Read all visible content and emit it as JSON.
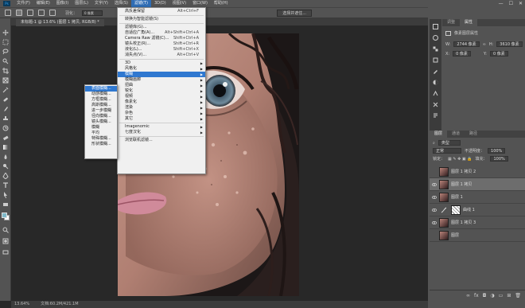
{
  "menubar": {
    "logo": "Ps",
    "items": [
      "文件(F)",
      "编辑(E)",
      "图像(I)",
      "图层(L)",
      "文字(Y)",
      "选择(S)",
      "滤镜(T)",
      "3D(D)",
      "视图(V)",
      "窗口(W)",
      "帮助(H)"
    ],
    "active_index": 6,
    "window_buttons": [
      "—",
      "☐",
      "✕"
    ]
  },
  "options_bar": {
    "feather_label": "羽化：",
    "feather_value": "0 像素",
    "refine_button": "选择并遮住..."
  },
  "document": {
    "tab_title": "未标题-1 @ 13.6% (图层 1 拷贝, RGB/8) *",
    "zoom": "13.64%",
    "doc_info": "文档:60.2M/421.1M"
  },
  "filter_menu": {
    "items": [
      {
        "label": "高反差保留",
        "shortcut": "Alt+Ctrl+F"
      },
      {
        "sep": true
      },
      {
        "label": "转换为智能滤镜(S)"
      },
      {
        "sep": true
      },
      {
        "label": "滤镜库(G)..."
      },
      {
        "label": "自适应广角(A)...",
        "shortcut": "Alt+Shift+Ctrl+A"
      },
      {
        "label": "Camera Raw 滤镜(C)...",
        "shortcut": "Shift+Ctrl+A"
      },
      {
        "label": "镜头校正(R)...",
        "shortcut": "Shift+Ctrl+R"
      },
      {
        "label": "液化(L)...",
        "shortcut": "Shift+Ctrl+X"
      },
      {
        "label": "消失点(V)...",
        "shortcut": "Alt+Ctrl+V"
      },
      {
        "sep": true
      },
      {
        "label": "3D",
        "sub": true
      },
      {
        "label": "风格化",
        "sub": true
      },
      {
        "label": "模糊",
        "sub": true,
        "highlight": true
      },
      {
        "label": "模糊画廊",
        "sub": true
      },
      {
        "label": "扭曲",
        "sub": true
      },
      {
        "label": "锐化",
        "sub": true
      },
      {
        "label": "视频",
        "sub": true
      },
      {
        "label": "像素化",
        "sub": true
      },
      {
        "label": "渲染",
        "sub": true
      },
      {
        "label": "杂色",
        "sub": true
      },
      {
        "label": "其它",
        "sub": true
      },
      {
        "sep": true
      },
      {
        "label": "Imagenomic",
        "sub": true
      },
      {
        "label": "七度汉化",
        "sub": true
      },
      {
        "sep": true
      },
      {
        "label": "浏览联机滤镜..."
      }
    ]
  },
  "blur_submenu": {
    "items": [
      {
        "label": "表面模糊...",
        "highlight": true
      },
      {
        "label": "动感模糊..."
      },
      {
        "label": "方框模糊..."
      },
      {
        "label": "高斯模糊..."
      },
      {
        "label": "进一步模糊"
      },
      {
        "label": "径向模糊..."
      },
      {
        "label": "镜头模糊..."
      },
      {
        "label": "模糊"
      },
      {
        "label": "平均"
      },
      {
        "label": "特殊模糊..."
      },
      {
        "label": "形状模糊..."
      }
    ]
  },
  "properties_panel": {
    "tabs": [
      "调整",
      "属性"
    ],
    "title": "像素图层属性",
    "w_label": "W:",
    "w_value": "2744 像素",
    "h_label": "H:",
    "h_value": "3610 像素",
    "x_label": "X:",
    "x_value": "0 像素",
    "y_label": "Y:",
    "y_value": "0 像素"
  },
  "layers_panel": {
    "tabs": [
      "图层",
      "通道",
      "路径"
    ],
    "kind_label": "类型",
    "blend_mode": "正常",
    "opacity_label": "不透明度：",
    "opacity_value": "100%",
    "lock_label": "锁定：",
    "fill_label": "填充：",
    "fill_value": "100%",
    "layers": [
      {
        "name": "图层 1 拷贝 2",
        "visible": false,
        "selected": false,
        "mask": false
      },
      {
        "name": "图层 1 拷贝",
        "visible": true,
        "selected": true,
        "mask": false
      },
      {
        "name": "图层 1",
        "visible": true,
        "selected": false,
        "mask": false
      },
      {
        "name": "曲线 1",
        "visible": true,
        "selected": false,
        "mask": true
      },
      {
        "name": "图层 1 拷贝 3",
        "visible": true,
        "selected": false,
        "mask": false
      },
      {
        "name": "图层",
        "visible": false,
        "selected": false,
        "mask": false
      }
    ],
    "footer_icons": [
      "link-icon",
      "fx-icon",
      "mask-icon",
      "adjustment-icon",
      "folder-icon",
      "new-layer-icon",
      "trash-icon"
    ]
  }
}
